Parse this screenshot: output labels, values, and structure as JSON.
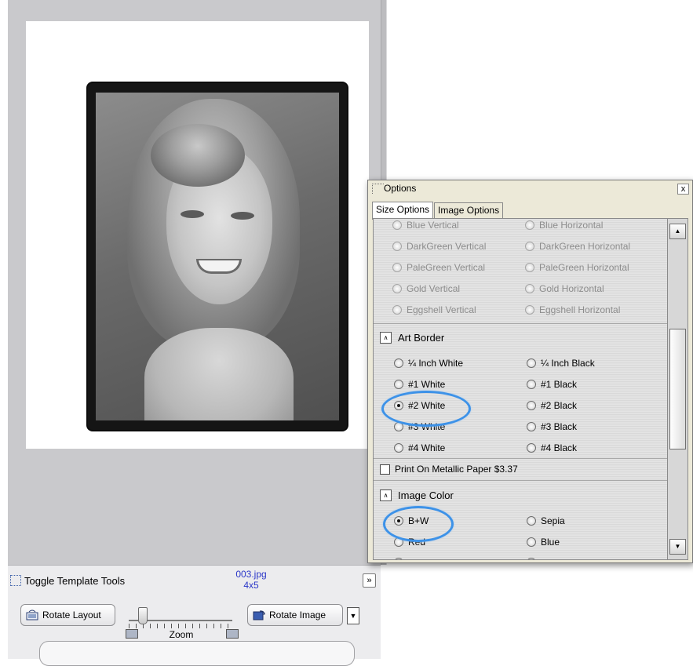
{
  "tools": {
    "toggle_label": "Toggle Template Tools",
    "file_name": "003.jpg",
    "print_size": "4x5",
    "collapse_glyph": "»",
    "rotate_layout_label": "Rotate Layout",
    "rotate_image_label": "Rotate Image",
    "dropdown_glyph": "▼",
    "zoom_label": "Zoom",
    "zoom_level": 0.13
  },
  "options": {
    "title": "Options",
    "close_glyph": "x",
    "tabs": [
      {
        "label": "Size Options",
        "active": true
      },
      {
        "label": "Image Options",
        "active": false
      }
    ],
    "color_mats": [
      {
        "left": "Blue Vertical",
        "right": "Blue Horizontal"
      },
      {
        "left": "DarkGreen Vertical",
        "right": "DarkGreen Horizontal"
      },
      {
        "left": "PaleGreen Vertical",
        "right": "PaleGreen Horizontal"
      },
      {
        "left": "Gold Vertical",
        "right": "Gold Horizontal"
      },
      {
        "left": "Eggshell Vertical",
        "right": "Eggshell Horizontal"
      }
    ],
    "art_border": {
      "title": "Art Border",
      "toggle_glyph": "∧",
      "options": [
        {
          "left": "¼ Inch White",
          "right": "¼ Inch Black"
        },
        {
          "left": "#1 White",
          "right": "#1 Black"
        },
        {
          "left": "#2 White",
          "right": "#2 Black"
        },
        {
          "left": "#3 White",
          "right": "#3 Black"
        },
        {
          "left": "#4 White",
          "right": "#4 Black"
        }
      ],
      "selected": "#2 White"
    },
    "metallic_label": "Print On Metallic Paper $3.37",
    "metallic_checked": false,
    "image_color": {
      "title": "Image Color",
      "toggle_glyph": "∧",
      "options": [
        {
          "left": "B+W",
          "right": "Sepia"
        },
        {
          "left": "Red",
          "right": "Blue"
        }
      ],
      "selected": "B+W"
    },
    "scroll_up_glyph": "▲",
    "scroll_down_glyph": "▼"
  },
  "colors": {
    "highlight": "#3d92e8",
    "file_info": "#2b37c8"
  }
}
